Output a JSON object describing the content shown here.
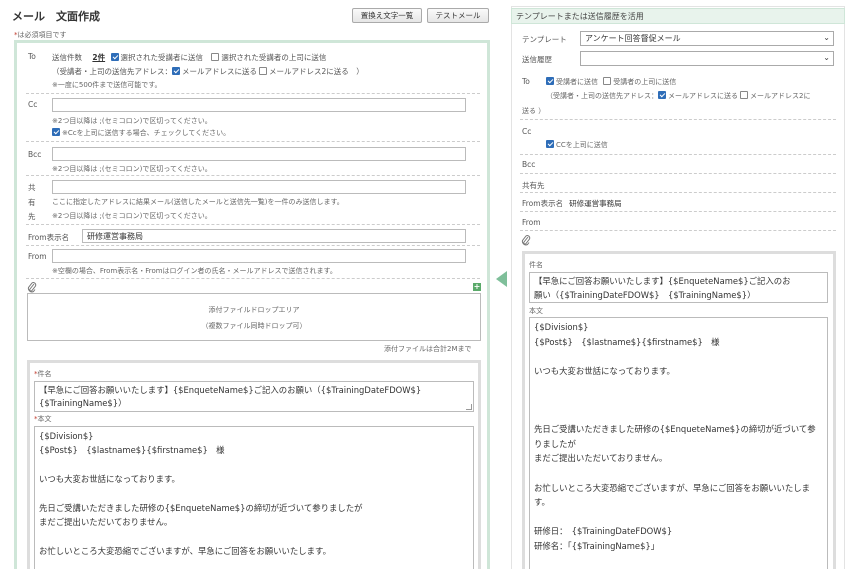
{
  "header": {
    "title": "メール　文面作成",
    "replace_btn": "置換え文字一覧",
    "test_btn": "テストメール",
    "required_note": "は必須項目です"
  },
  "to": {
    "label": "To",
    "count_label": "送信件数",
    "count_value": "2件",
    "opt_selected": "選択された受講者に送信",
    "opt_boss": "選択された受講者の上司に送信",
    "addr_prefix": "（受講者・上司の送信先アドレス：",
    "addr1": "メールアドレスに送る",
    "addr2": "メールアドレス2に送る　）",
    "note": "※一度に500件まで送信可能です。"
  },
  "cc": {
    "label": "Cc",
    "value": "",
    "note": "※2つ目以降は ;(セミコロン)で区切ってください。",
    "check": "※Ccを上司に送信する場合、チェックしてください。"
  },
  "bcc": {
    "label": "Bcc",
    "value": "",
    "note": "※2つ目以降は ;(セミコロン)で区切ってください。"
  },
  "shared": {
    "label_1": "共",
    "label_2": "有",
    "label_3": "先",
    "value": "",
    "note1": "ここに指定したアドレスに結果メール(送信したメールと送信先一覧)を一件のみ送信します。",
    "note2": "※2つ目以降は ;(セミコロン)で区切ってください。"
  },
  "from_name": {
    "label": "From表示名",
    "value": "研修運営事務局"
  },
  "from": {
    "label": "From",
    "value": "",
    "note": "※空欄の場合、From表示名・Fromはログイン者の氏名・メールアドレスで送信されます。"
  },
  "attach": {
    "drop1": "添付ファイルドロップエリア",
    "drop2": "（複数ファイル同時ドロップ可）",
    "limit": "添付ファイルは合計2Mまで"
  },
  "subject": {
    "label": "件名",
    "line1": "【早急にご回答お願いいたします】{$EnqueteName$}ご記入のお願い（{$TrainingDateFDOW$}",
    "line2": "{$TrainingName$}）"
  },
  "body": {
    "label": "本文",
    "lines": [
      "{$Division$}",
      "{$Post$}　{$lastname$}{$firstname$}　様",
      "",
      "いつも大変お世話になっております。",
      "",
      "先日ご受講いただきました研修の{$EnqueteName$}の締切が近づいて参りましたが",
      "まだご提出いただいておりません。",
      "",
      "お忙しいところ大変恐縮でございますが、早急にご回答をお願いいたします。"
    ]
  },
  "right": {
    "header": "テンプレートまたは送信履歴を活用",
    "template_label": "テンプレート",
    "template_value": "アンケート回答督促メール",
    "history_label": "送信履歴",
    "history_value": "",
    "to_label": "To",
    "to_opt1": "受講者に送信",
    "to_opt2": "受講者の上司に送信",
    "to_addr_prefix": "（受講者・上司の送信先アドレス：",
    "to_addr1": "メールアドレスに送る",
    "to_addr2": "メールアドレス2に",
    "to_addr_tail": "送る ）",
    "cc_label": "Cc",
    "cc_check": "CCを上司に送信",
    "bcc_label": "Bcc",
    "shared_label": "共有先",
    "from_name_label": "From表示名",
    "from_name_value": "研修運営事務局",
    "from_label": "From",
    "subject_label": "件名",
    "subject_line1": "【早急にご回答お願いいたします】{$EnqueteName$}ご記入のお",
    "subject_line2": "願い（{$TrainingDateFDOW$}　{$TrainingName$}）",
    "body_label": "本文",
    "body_lines": [
      "{$Division$}",
      "{$Post$}　{$lastname$}{$firstname$}　様",
      "",
      "いつも大変お世話になっております。",
      "",
      "",
      "",
      "先日ご受講いただきました研修の{$EnqueteName$}の締切が近づいて参りましたが",
      "まだご提出いただいておりません。",
      "",
      "お忙しいところ大変恐縮でございますが、早急にご回答をお願いいたします。",
      "",
      "研修日：　{$TrainingDateFDOW$}",
      "研修名：「{$TrainingName$}」"
    ]
  },
  "colors": {
    "accent_green": "#cfe6d8",
    "panel_green": "#e8f3ec",
    "arrow": "#7fbf9a"
  }
}
